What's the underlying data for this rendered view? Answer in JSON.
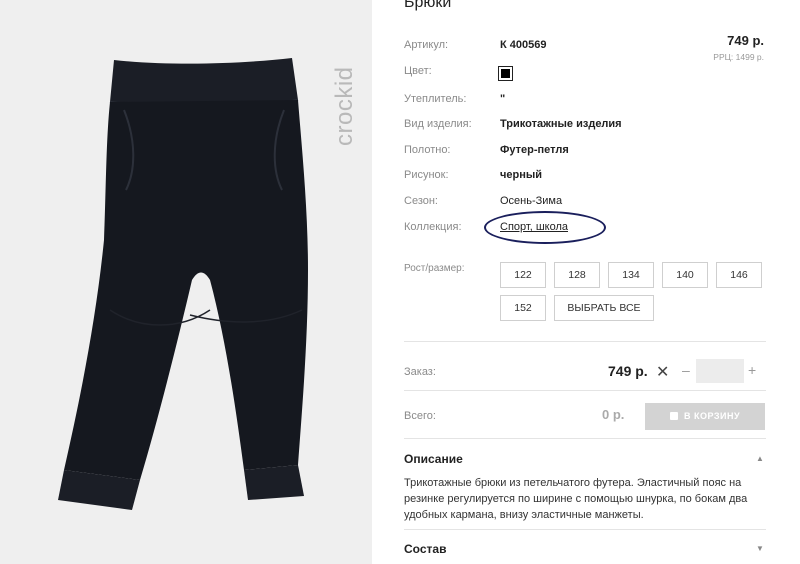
{
  "product": {
    "brand": "crockid",
    "title": "Брюки",
    "price": "749 р.",
    "rrp": "РРЦ: 1499 р."
  },
  "attributes": [
    {
      "label": "Артикул:",
      "value": "К 400569",
      "bold": true
    },
    {
      "label": "Цвет:",
      "value": "",
      "swatch": "#000000"
    },
    {
      "label": "Утеплитель:",
      "value": "\"",
      "bold": true
    },
    {
      "label": "Вид изделия:",
      "value": "Трикотажные изделия",
      "bold": true
    },
    {
      "label": "Полотно:",
      "value": "Футер-петля",
      "bold": true
    },
    {
      "label": "Рисунок:",
      "value": "черный",
      "bold": true
    },
    {
      "label": "Сезон:",
      "value": "Осень-Зима",
      "bold": false
    },
    {
      "label": "Коллекция:",
      "value": "Спорт, школа",
      "bold": false,
      "link": true
    }
  ],
  "sizes": {
    "label": "Рост/размер:",
    "options": [
      "122",
      "128",
      "134",
      "140",
      "146",
      "152"
    ],
    "select_all": "ВЫБРАТЬ ВСЕ"
  },
  "order": {
    "label": "Заказ:",
    "price": "749 р.",
    "times": "✕",
    "minus": "–",
    "plus": "+",
    "quantity": ""
  },
  "total": {
    "label": "Всего:",
    "value": "0 р.",
    "cart_button": "В КОРЗИНУ"
  },
  "description": {
    "title": "Описание",
    "text": "Трикотажные брюки из петельчатого футера. Эластичный пояс на резинке регулируется по ширине с помощью шнурка, по бокам два удобных кармана, внизу эластичные манжеты."
  },
  "composition": {
    "title": "Состав"
  },
  "colors": {
    "annotation": "#1a1f5c",
    "cart_disabled": "#d3d3d3",
    "gallery_bg": "#efefef"
  }
}
